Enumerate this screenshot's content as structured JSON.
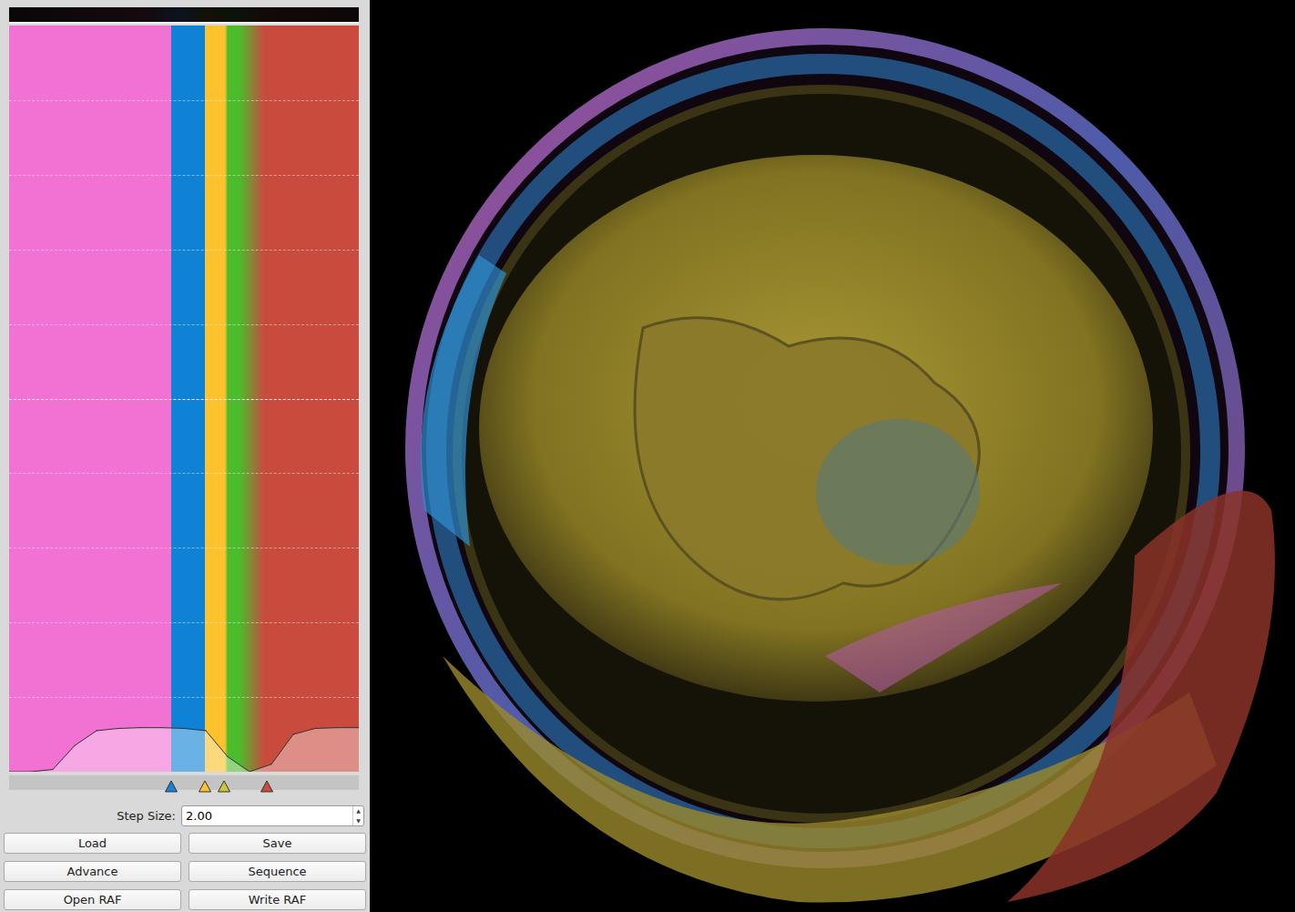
{
  "transfer_function": {
    "color_stops": [
      {
        "position": 0,
        "color": "#f272d3"
      },
      {
        "position": 0.464,
        "color": "#f272d3"
      },
      {
        "position": 0.464,
        "color": "#0f82d6"
      },
      {
        "position": 0.56,
        "color": "#0f82d6"
      },
      {
        "position": 0.56,
        "color": "#fdc22c"
      },
      {
        "position": 0.617,
        "color": "#fdc22c"
      },
      {
        "position": 0.625,
        "color": "#4cbb2c"
      },
      {
        "position": 0.66,
        "color": "#4cbb2c"
      },
      {
        "position": 0.73,
        "color": "#c94b3e"
      },
      {
        "position": 1,
        "color": "#c94b3e"
      }
    ],
    "opacity": [
      0,
      0,
      0.003,
      0.035,
      0.055,
      0.058,
      0.059,
      0.059,
      0.058,
      0.055,
      0.02,
      0,
      0.01,
      0.05,
      0.058,
      0.059,
      0.059
    ],
    "markers": [
      {
        "position": 0.464,
        "color": "#1a80d6"
      },
      {
        "position": 0.56,
        "color": "#fdc22c"
      },
      {
        "position": 0.615,
        "color": "#c8c83a"
      },
      {
        "position": 0.737,
        "color": "#c94b3e"
      }
    ]
  },
  "step_size": {
    "label": "Step Size:",
    "value": "2.00"
  },
  "buttons": [
    "Load",
    "Save",
    "Advance",
    "Sequence",
    "Open RAF",
    "Write RAF"
  ]
}
